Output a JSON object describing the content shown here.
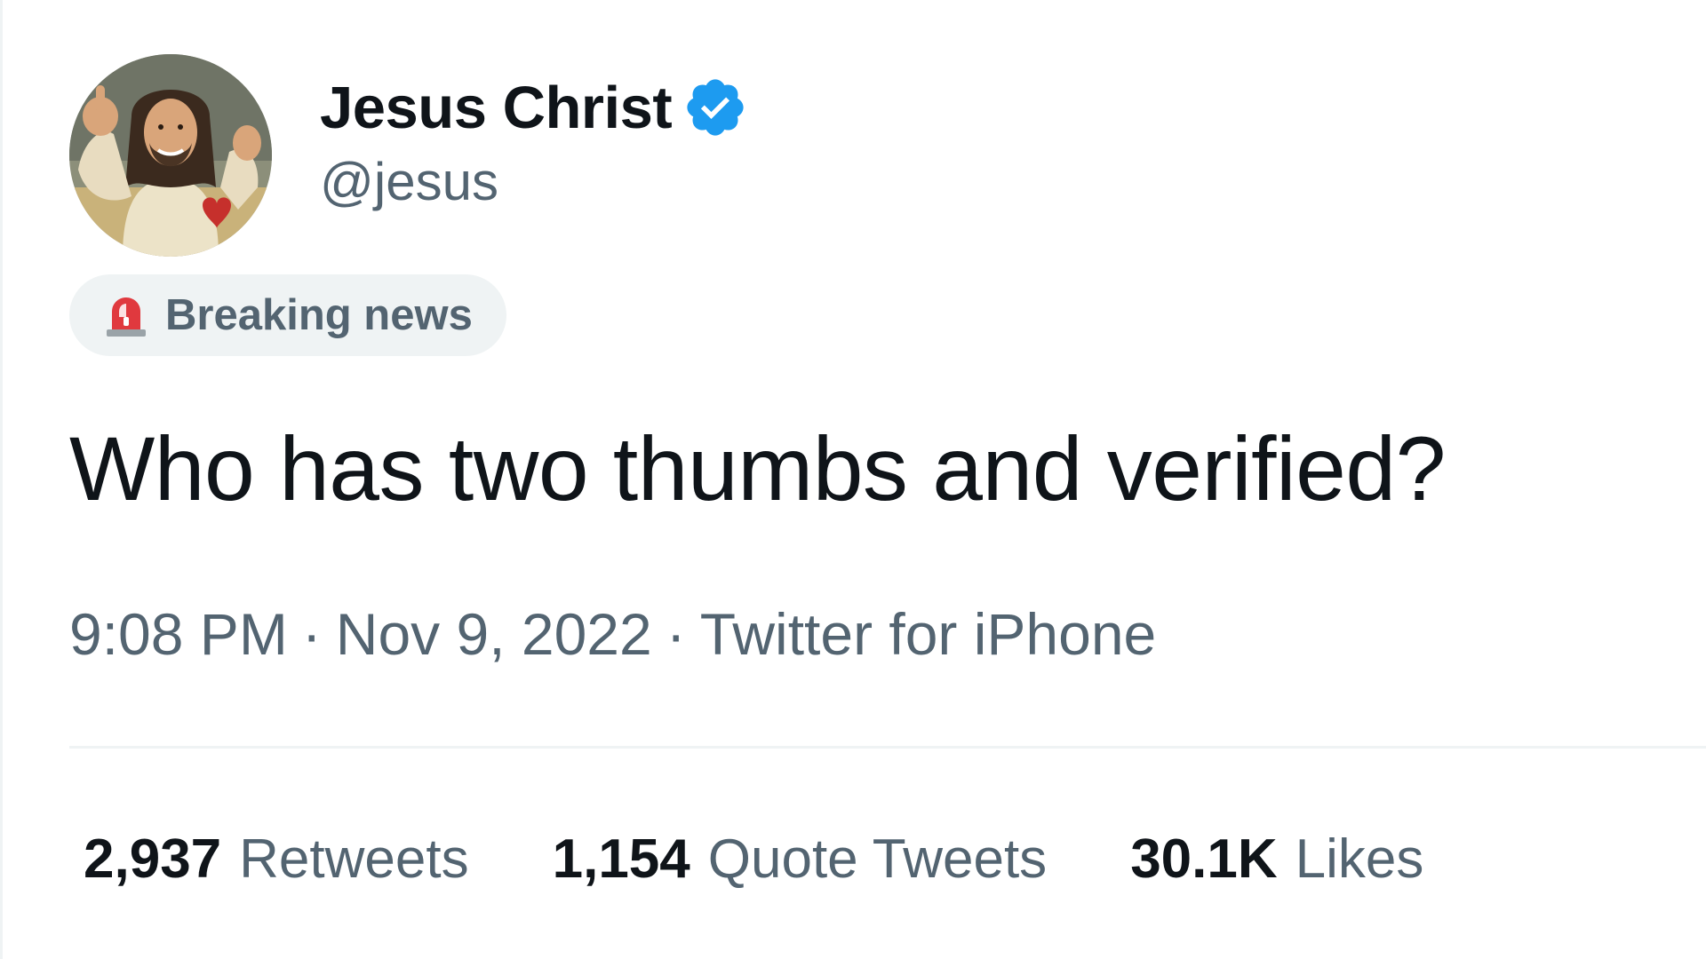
{
  "author": {
    "display_name": "Jesus Christ",
    "handle": "@jesus",
    "verified": true,
    "verified_color": "#1d9bf0",
    "avatar_icon": "avatar-portrait"
  },
  "label": {
    "icon": "siren-icon",
    "text": "Breaking news"
  },
  "tweet": {
    "text": "Who has two thumbs and verified?"
  },
  "meta": {
    "time": "9:08 PM",
    "separator": "·",
    "date": "Nov 9, 2022",
    "source": "Twitter for iPhone"
  },
  "stats": [
    {
      "count": "2,937",
      "label": "Retweets"
    },
    {
      "count": "1,154",
      "label": "Quote Tweets"
    },
    {
      "count": "30.1K",
      "label": "Likes"
    }
  ],
  "colors": {
    "primary_text": "#0f1419",
    "secondary_text": "#536471",
    "pill_background": "#eff3f4",
    "divider": "#eff3f4"
  }
}
